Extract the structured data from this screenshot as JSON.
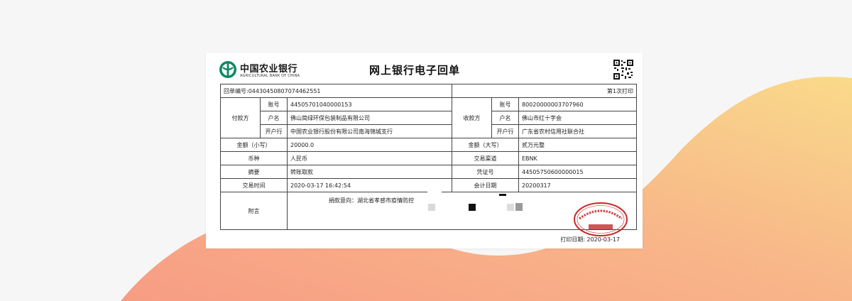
{
  "bank": {
    "name_cn": "中国农业银行",
    "name_en": "AGRICULTURAL BANK OF CHINA"
  },
  "receipt": {
    "title": "网上银行电子回单",
    "receipt_no_label": "回单编号:",
    "receipt_no": "04430450807074462551",
    "print_count": "第1次打印",
    "payer": {
      "group_label": "付款方",
      "account_label": "账号",
      "account": "44505701040000153",
      "name_label": "户名",
      "name": "佛山简绿环保包装制品有限公司",
      "bank_label": "开户行",
      "bank": "中国农业银行股份有限公司南海锦城支行"
    },
    "payee": {
      "group_label": "收款方",
      "account_label": "账号",
      "account": "80020000003707960",
      "name_label": "户名",
      "name": "佛山市红十字会",
      "bank_label": "开户行",
      "bank": "广东省农村信用社联合社"
    },
    "amount_small_label": "金额（小写）",
    "amount_small": "20000.0",
    "amount_big_label": "金额（大写）",
    "amount_big": "贰万元整",
    "currency_label": "币种",
    "currency": "人民币",
    "channel_label": "交易渠道",
    "channel": "EBNK",
    "summary_label": "摘要",
    "summary": "转账取款",
    "voucher_label": "凭证号",
    "voucher": "44505750600000015",
    "txn_time_label": "交易时间",
    "txn_time": "2020-03-17 16:42:54",
    "acct_date_label": "会计日期",
    "acct_date": "20200317",
    "remark_label": "附言",
    "remark": "捐款意向：湖北省孝感市疫情防控",
    "print_date_label": "打印日期:",
    "print_date": "2020-03-17",
    "stamp_text": "中国农业银行股份有限公司",
    "stamp_sub": "回单专用章"
  },
  "colors": {
    "bank_green": "#0b8a5f",
    "stamp_red": "#c8282a",
    "wave_orange": "#f7a983",
    "wave_yellow": "#f9d98a"
  }
}
